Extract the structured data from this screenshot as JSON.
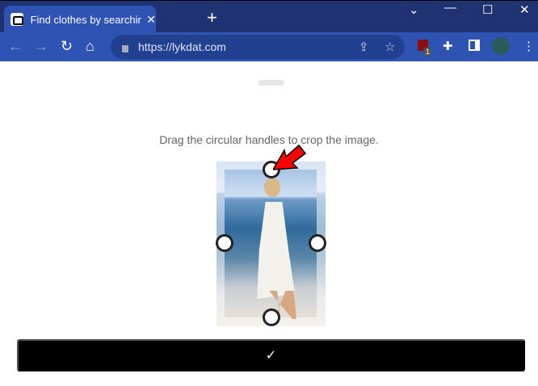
{
  "browser": {
    "tab_title": "Find clothes by searching with image",
    "url": "https://lykdat.com",
    "extension_badge": "1",
    "colors": {
      "frame": "#1f3372",
      "toolbar": "#2f53b3"
    }
  },
  "page": {
    "instruction": "Drag the circular handles to crop the image.",
    "confirm_label": "✓"
  },
  "annotation": {
    "color": "#ff0000"
  }
}
